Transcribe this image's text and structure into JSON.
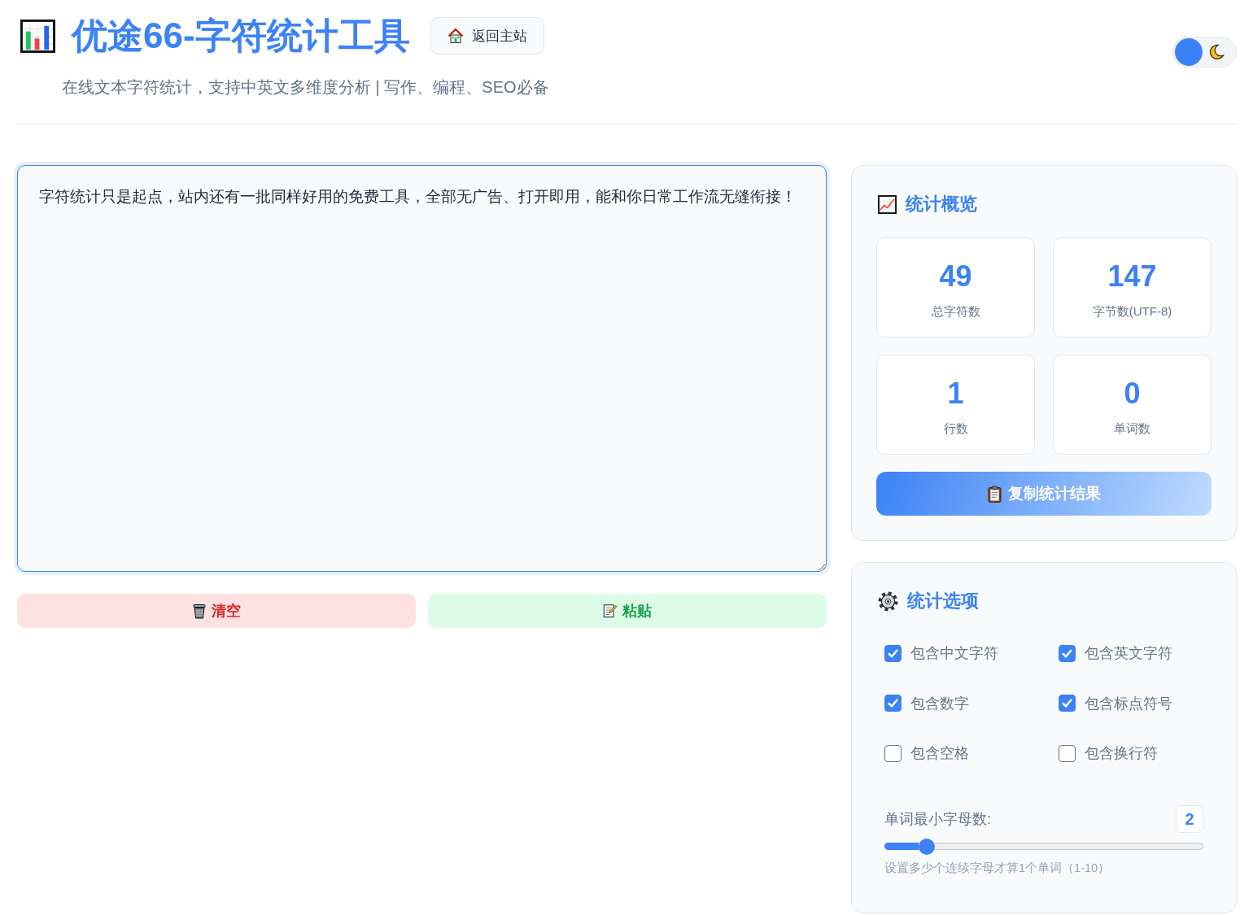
{
  "header": {
    "title": "优途66-字符统计工具",
    "home_button": "返回主站",
    "subtitle": "在线文本字符统计，支持中英文多维度分析 | 写作、编程、SEO必备"
  },
  "theme_toggle": {
    "dark": false
  },
  "editor": {
    "value": "字符统计只是起点，站内还有一批同样好用的免费工具，全部无广告、打开即用，能和你日常工作流无缝衔接！",
    "focused": true,
    "buttons": [
      {
        "kind": "clear",
        "label": "清空"
      },
      {
        "kind": "paste",
        "label": "粘贴"
      }
    ]
  },
  "stats_panel": {
    "title": "统计概览",
    "cards": [
      {
        "value": "49",
        "label": "总字符数"
      },
      {
        "value": "147",
        "label": "字节数(UTF-8)"
      },
      {
        "value": "1",
        "label": "行数"
      },
      {
        "value": "0",
        "label": "单词数"
      }
    ],
    "copy_button": "复制统计结果"
  },
  "options_panel": {
    "title": "统计选项",
    "options": [
      {
        "label": "包含中文字符",
        "checked": true
      },
      {
        "label": "包含英文字符",
        "checked": true
      },
      {
        "label": "包含数字",
        "checked": true
      },
      {
        "label": "包含标点符号",
        "checked": true
      },
      {
        "label": "包含空格",
        "checked": false
      },
      {
        "label": "包含换行符",
        "checked": false
      }
    ],
    "min_word_letters": {
      "label": "单词最小字母数:",
      "value": "2",
      "level": 0.11,
      "hint": "设置多少个连续字母才算1个单词（1-10）"
    }
  }
}
